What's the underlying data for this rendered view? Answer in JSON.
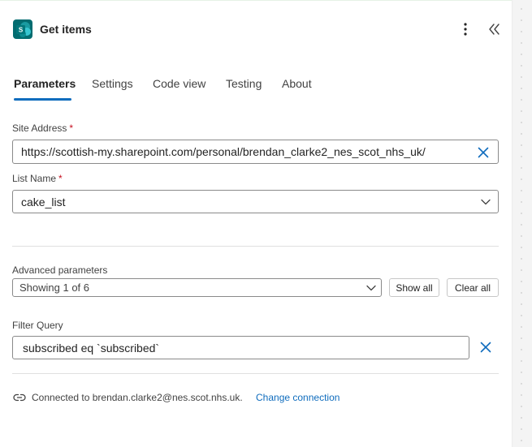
{
  "header": {
    "title": "Get items",
    "app_icon": "sharepoint-icon",
    "more_icon": "more-vertical-icon",
    "collapse_icon": "chevron-double-left-icon"
  },
  "tabs": [
    {
      "label": "Parameters",
      "active": true
    },
    {
      "label": "Settings",
      "active": false
    },
    {
      "label": "Code view",
      "active": false
    },
    {
      "label": "Testing",
      "active": false
    },
    {
      "label": "About",
      "active": false
    }
  ],
  "site_address": {
    "label": "Site Address",
    "required_mark": "*",
    "value": "https://scottish-my.sharepoint.com/personal/brendan_clarke2_nes_scot_nhs_uk/",
    "clear_icon": "close-icon"
  },
  "list_name": {
    "label": "List Name",
    "required_mark": "*",
    "value": "cake_list",
    "dropdown_icon": "chevron-down-icon"
  },
  "advanced": {
    "label": "Advanced parameters",
    "selected": "Showing 1 of 6",
    "show_all_label": "Show all",
    "clear_all_label": "Clear all"
  },
  "filter_query": {
    "label": "Filter Query",
    "value": "subscribed eq `subscribed`",
    "remove_icon": "close-icon"
  },
  "connection": {
    "text": "Connected to brendan.clarke2@nes.scot.nhs.uk.",
    "change_label": "Change connection",
    "icon": "connection-link-icon"
  },
  "colors": {
    "accent": "#0f6cbd",
    "required": "#c50f1f",
    "sharepoint": "#036c70"
  }
}
